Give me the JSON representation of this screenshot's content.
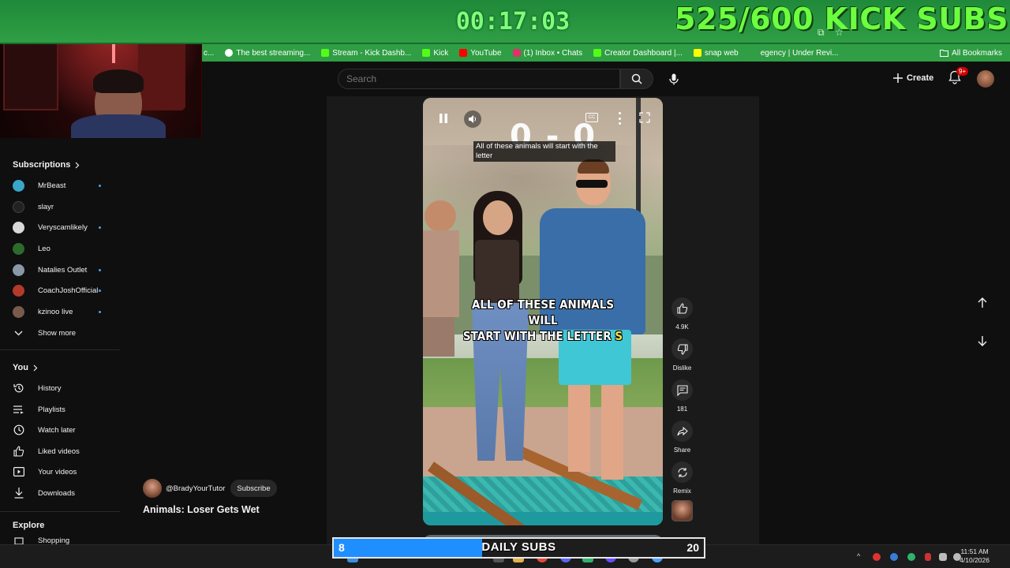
{
  "overlay": {
    "timer": "00:17:03",
    "kick_subs": "525/600 KICK SUBS"
  },
  "bookmarks": {
    "items": [
      {
        "label": "c...",
        "color": "#8a8a8a"
      },
      {
        "label": "The best streaming...",
        "color": "#ffffff"
      },
      {
        "label": "Stream - Kick Dashb...",
        "color": "#53fc18"
      },
      {
        "label": "Kick",
        "color": "#53fc18"
      },
      {
        "label": "YouTube",
        "color": "#ff0000"
      },
      {
        "label": "(1) Inbox • Chats",
        "color": "#e1306c"
      },
      {
        "label": "Creator Dashboard |...",
        "color": "#53fc18"
      },
      {
        "label": "snap web",
        "color": "#fffc00"
      },
      {
        "label": "egency | Under Revi...",
        "color": "#2f9e44"
      }
    ],
    "all_label": "All Bookmarks"
  },
  "header": {
    "search_placeholder": "Search",
    "create_label": "Create",
    "notif_count": "9+"
  },
  "sidebar": {
    "subscriptions_label": "Subscriptions",
    "channels": [
      {
        "name": "MrBeast",
        "color": "#3aa6c9",
        "live": true
      },
      {
        "name": "slayr",
        "color": "#222222",
        "live": false
      },
      {
        "name": "Veryscamlikely",
        "color": "#d9d9d9",
        "live": true
      },
      {
        "name": "Leo",
        "color": "#2d6a2d",
        "live": false
      },
      {
        "name": "Natalies Outlet",
        "color": "#8a97a6",
        "live": true
      },
      {
        "name": "CoachJoshOfficial",
        "color": "#b33a2a",
        "live": true
      },
      {
        "name": "kzinoo live",
        "color": "#7a5a4a",
        "live": true
      }
    ],
    "show_more": "Show more",
    "you_label": "You",
    "you_items": [
      {
        "label": "History",
        "icon": "history-icon"
      },
      {
        "label": "Playlists",
        "icon": "playlists-icon"
      },
      {
        "label": "Watch later",
        "icon": "watch-later-icon"
      },
      {
        "label": "Liked videos",
        "icon": "liked-videos-icon"
      },
      {
        "label": "Your videos",
        "icon": "your-videos-icon"
      },
      {
        "label": "Downloads",
        "icon": "downloads-icon"
      }
    ],
    "explore_label": "Explore",
    "explore_cut": "Shopping"
  },
  "short": {
    "caption_top": "All of these animals will start with the letter",
    "score": "0 - 0",
    "caption_main_1": "ALL OF THESE ANIMALS WILL",
    "caption_main_2": "START WITH THE LETTER",
    "caption_main_letter": "S",
    "like_count": "4.9K",
    "dislike_label": "Dislike",
    "comment_count": "181",
    "share_label": "Share",
    "remix_label": "Remix",
    "channel": "@BradyYourTutor",
    "subscribe_label": "Subscribe",
    "title": "Animals: Loser Gets Wet"
  },
  "daily_subs": {
    "label": "DAILY SUBS",
    "current": "8",
    "goal": "20",
    "progress": 0.4
  },
  "taskbar": {
    "time": "11:51 AM",
    "date": "4/10/2026"
  },
  "colors": {
    "overlay_green": "#2f9e44",
    "kick_green": "#6cff3f",
    "daily_blue": "#1f8fff"
  }
}
